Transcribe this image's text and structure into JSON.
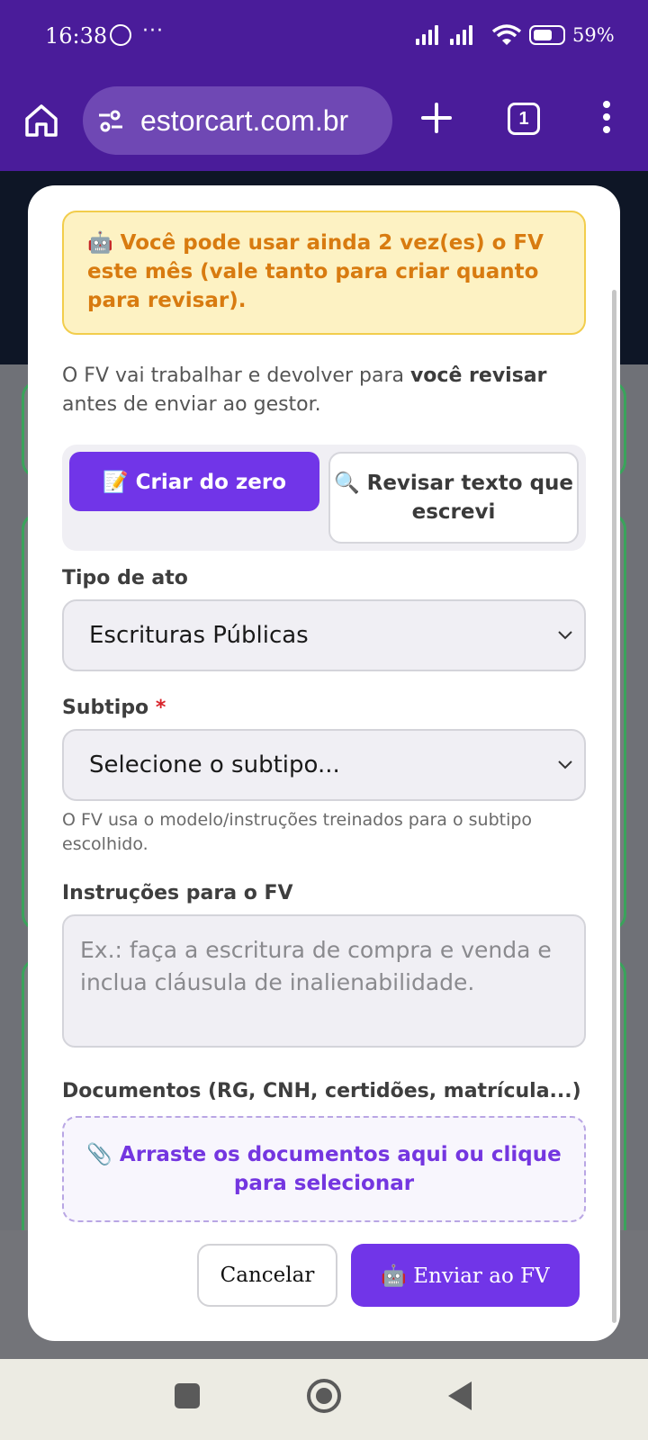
{
  "status_bar": {
    "time": "16:38",
    "more": "···",
    "battery": "59%"
  },
  "browser": {
    "url": "estorcart.com.br",
    "tab_count": "1"
  },
  "modal": {
    "quota_icon": "🤖",
    "quota_text": "Você pode usar ainda 2 vez(es) o FV este mês (vale tanto para criar quanto para revisar).",
    "intro_before": "O FV vai trabalhar e devolver para ",
    "intro_bold": "você revisar",
    "intro_after": " antes de enviar ao gestor.",
    "mode_create": "📝 Criar do zero",
    "mode_review": "🔍 Revisar texto que escrevi",
    "tipo_label": "Tipo de ato",
    "tipo_value": "Escrituras Públicas",
    "subtipo_label": "Subtipo",
    "required_mark": "*",
    "subtipo_placeholder": "Selecione o subtipo...",
    "subtipo_help": "O FV usa o modelo/instruções treinados para o subtipo escolhido.",
    "instrucoes_label": "Instruções para o FV",
    "instrucoes_placeholder": "Ex.: faça a escritura de compra e venda e inclua cláusula de inalienabilidade.",
    "documentos_label": "Documentos (RG, CNH, certidões, matrícula...)",
    "dropzone_text": "📎 Arraste os documentos aqui ou clique para selecionar",
    "cancel_label": "Cancelar",
    "send_label": "🤖 Enviar ao FV"
  },
  "colors": {
    "browser_bar": "#4a1c9a",
    "accent": "#7135e8",
    "warning_bg": "#fdf2c3",
    "warning_text": "#d87b10"
  }
}
